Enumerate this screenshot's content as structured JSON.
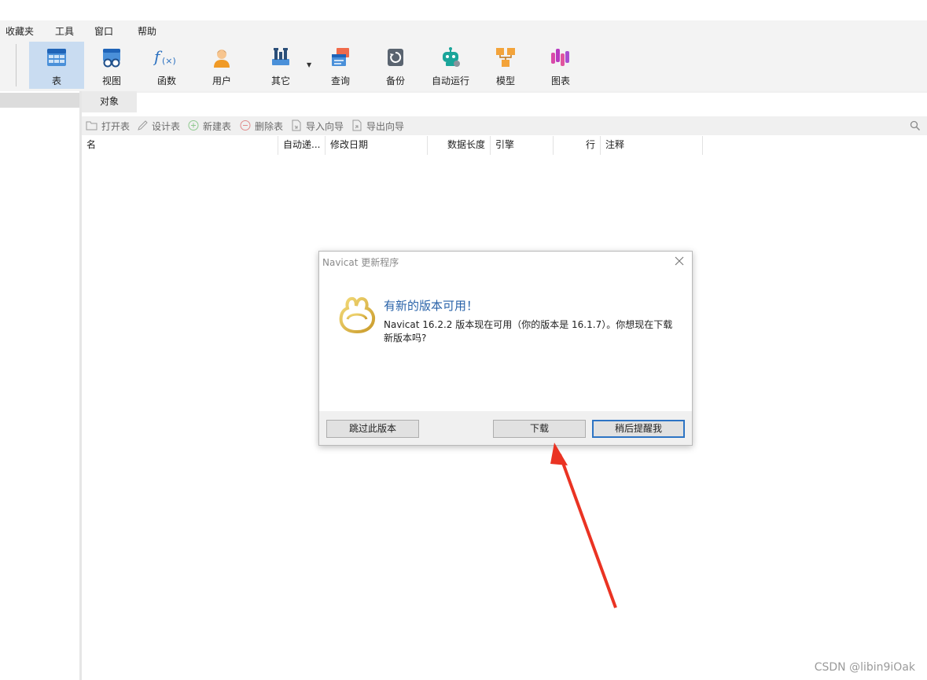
{
  "menu": [
    "收藏夹",
    "工具",
    "窗口",
    "帮助"
  ],
  "toolbar": {
    "buttons": [
      {
        "label": "表",
        "icon": "table-icon",
        "active": true
      },
      {
        "label": "视图",
        "icon": "view-icon",
        "active": false
      },
      {
        "label": "函数",
        "icon": "function-icon",
        "active": false
      },
      {
        "label": "用户",
        "icon": "user-icon",
        "active": false
      },
      {
        "label": "其它",
        "icon": "tools-icon",
        "active": false
      },
      {
        "label": "查询",
        "icon": "query-icon",
        "active": false
      },
      {
        "label": "备份",
        "icon": "backup-icon",
        "active": false
      },
      {
        "label": "自动运行",
        "icon": "robot-icon",
        "active": false
      },
      {
        "label": "模型",
        "icon": "model-icon",
        "active": false
      },
      {
        "label": "图表",
        "icon": "chart-icon",
        "active": false
      }
    ]
  },
  "tabs": {
    "objects": "对象"
  },
  "object_toolbar": {
    "open": "打开表",
    "design": "设计表",
    "new": "新建表",
    "delete": "删除表",
    "import": "导入向导",
    "export": "导出向导"
  },
  "columns": [
    "名",
    "自动递...",
    "修改日期",
    "数据长度",
    "引擎",
    "行",
    "注释"
  ],
  "dialog": {
    "title": "Navicat 更新程序",
    "heading": "有新的版本可用！",
    "message": "Navicat 16.2.2 版本现在可用（你的版本是 16.1.7）。你想现在下载新版本吗?",
    "skip": "跳过此版本",
    "download": "下载",
    "later": "稍后提醒我"
  },
  "watermark": "CSDN @libin9iOak",
  "colors": {
    "accent": "#2a63a9",
    "active_tab": "#c9dcf1",
    "arrow": "#ea3323"
  }
}
